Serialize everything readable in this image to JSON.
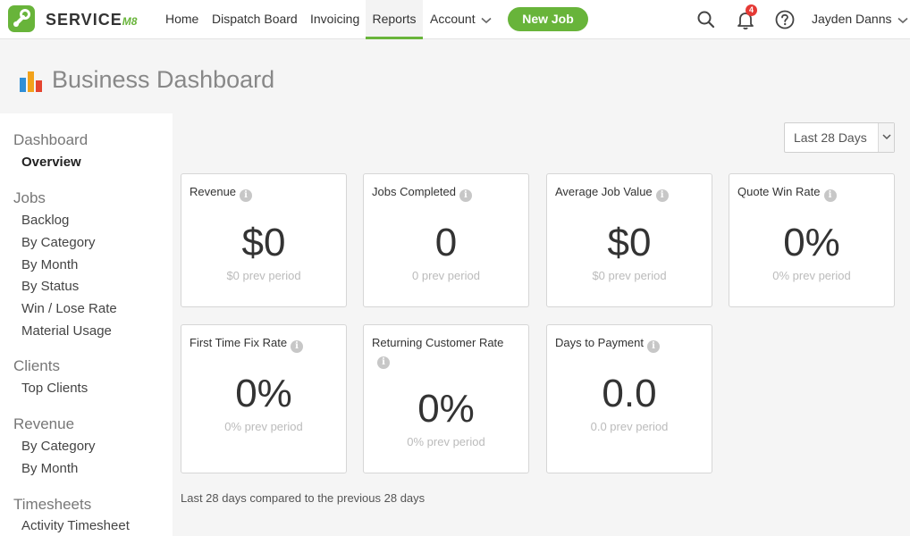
{
  "brand": {
    "name_main": "SERVICE",
    "name_suffix": "M8"
  },
  "nav": {
    "items": [
      {
        "label": "Home"
      },
      {
        "label": "Dispatch Board"
      },
      {
        "label": "Invoicing"
      },
      {
        "label": "Reports"
      },
      {
        "label": "Account"
      }
    ],
    "active": "Reports",
    "new_job_label": "New Job",
    "notification_count": "4",
    "user_name": "Jayden Danns"
  },
  "header": {
    "title": "Business Dashboard"
  },
  "sidebar": {
    "groups": [
      {
        "title": "Dashboard",
        "links": [
          "Overview"
        ]
      },
      {
        "title": "Jobs",
        "links": [
          "Backlog",
          "By Category",
          "By Month",
          "By Status",
          "Win / Lose Rate",
          "Material Usage"
        ]
      },
      {
        "title": "Clients",
        "links": [
          "Top Clients"
        ]
      },
      {
        "title": "Revenue",
        "links": [
          "By Category",
          "By Month"
        ]
      },
      {
        "title": "Timesheets",
        "links": [
          "Activity Timesheet"
        ]
      }
    ],
    "current": "Overview"
  },
  "filter": {
    "selected": "Last 28 Days"
  },
  "cards": [
    {
      "label": "Revenue",
      "value": "$0",
      "prev": "$0 prev period"
    },
    {
      "label": "Jobs Completed",
      "value": "0",
      "prev": "0 prev period"
    },
    {
      "label": "Average Job Value",
      "value": "$0",
      "prev": "$0 prev period"
    },
    {
      "label": "Quote Win Rate",
      "value": "0%",
      "prev": "0% prev period"
    },
    {
      "label": "First Time Fix Rate",
      "value": "0%",
      "prev": "0% prev period"
    },
    {
      "label": "Returning Customer Rate",
      "value": "0%",
      "prev": "0% prev period"
    },
    {
      "label": "Days to Payment",
      "value": "0.0",
      "prev": "0.0 prev period"
    }
  ],
  "footnote": "Last 28 days compared to the previous 28 days",
  "colors": {
    "brand_green": "#68b43a",
    "badge_red": "#e53935"
  },
  "icons": {
    "logo": "servicem8-logo-icon",
    "search": "search-icon",
    "notifications": "bell-icon",
    "help": "help-icon",
    "dashboard": "bar-chart-icon",
    "info": "info-icon"
  }
}
